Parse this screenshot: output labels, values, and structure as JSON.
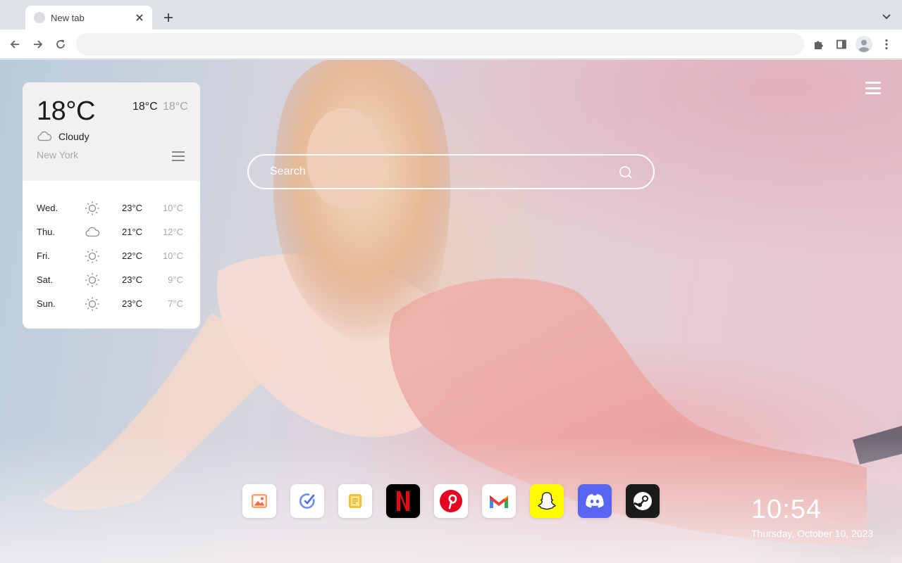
{
  "browser": {
    "tab": {
      "title": "New tab"
    },
    "omnibox": {
      "value": "",
      "placeholder": ""
    },
    "icons": [
      "tab-close-icon",
      "plus-icon",
      "chevron-down-icon",
      "back-arrow-icon",
      "forward-arrow-icon",
      "reload-icon",
      "puzzle-icon",
      "side-panel-icon",
      "profile-icon",
      "kebab-menu-icon"
    ]
  },
  "weather": {
    "current_temp": "18°C",
    "high": "18°C",
    "low": "18°C",
    "condition": "Cloudy",
    "condition_icon": "cloud-icon",
    "city": "New York",
    "forecast": [
      {
        "day": "Wed.",
        "icon": "sun-icon",
        "high": "23°C",
        "low": "10°C"
      },
      {
        "day": "Thu.",
        "icon": "cloud-icon",
        "high": "21°C",
        "low": "12°C"
      },
      {
        "day": "Fri.",
        "icon": "sun-icon",
        "high": "22°C",
        "low": "10°C"
      },
      {
        "day": "Sat.",
        "icon": "sun-icon",
        "high": "23°C",
        "low": "9°C"
      },
      {
        "day": "Sun.",
        "icon": "sun-icon",
        "high": "23°C",
        "low": "7°C"
      }
    ]
  },
  "search": {
    "placeholder": "Search"
  },
  "dock": [
    {
      "name": "gallery",
      "icon": "image-icon",
      "bg": "#ffffff"
    },
    {
      "name": "tasks",
      "icon": "check-circle-icon",
      "bg": "#ffffff"
    },
    {
      "name": "notes",
      "icon": "notes-icon",
      "bg": "#ffffff"
    },
    {
      "name": "netflix",
      "icon": "netflix-icon",
      "bg": "#000000",
      "accent": "#e50914"
    },
    {
      "name": "pinterest",
      "icon": "pinterest-icon",
      "bg": "#ffffff",
      "accent": "#e60023"
    },
    {
      "name": "gmail",
      "icon": "gmail-icon",
      "bg": "#ffffff"
    },
    {
      "name": "snapchat",
      "icon": "snapchat-icon",
      "bg": "#fffc00"
    },
    {
      "name": "discord",
      "icon": "discord-icon",
      "bg": "#5865f2"
    },
    {
      "name": "steam",
      "icon": "steam-icon",
      "bg": "#1b1b1b"
    }
  ],
  "clock": {
    "time": "10:54",
    "date": "Thursday, October 10, 2023"
  }
}
